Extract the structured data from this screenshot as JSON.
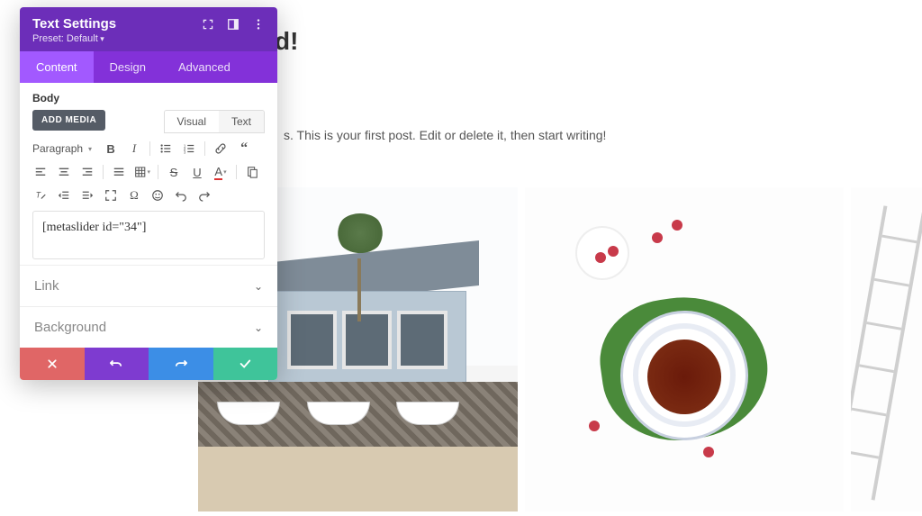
{
  "page": {
    "title_fragment": "d!",
    "subtext": "s. This is your first post. Edit or delete it, then start writing!"
  },
  "panel": {
    "title": "Text Settings",
    "preset": "Preset: Default",
    "tabs": {
      "content": "Content",
      "design": "Design",
      "advanced": "Advanced"
    },
    "body_label": "Body",
    "add_media": "ADD MEDIA",
    "editor_tabs": {
      "visual": "Visual",
      "text": "Text"
    },
    "format_dropdown": "Paragraph",
    "shortcode": "[metaslider id=\"34\"]",
    "accordion": {
      "link": "Link",
      "background": "Background"
    }
  }
}
